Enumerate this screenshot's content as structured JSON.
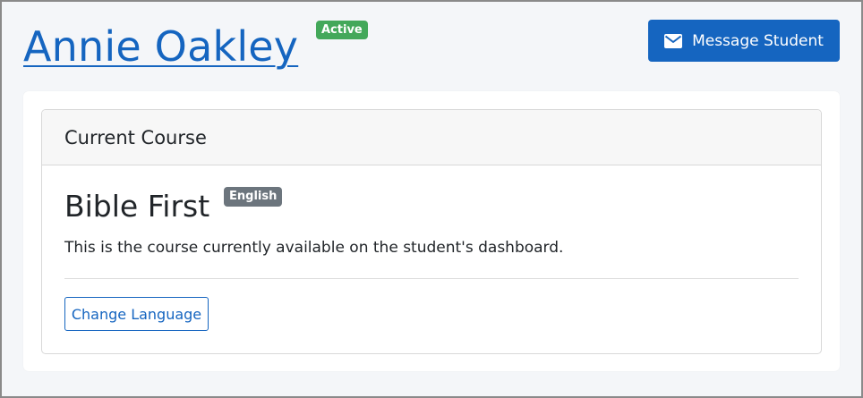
{
  "header": {
    "student_name": "Annie Oakley",
    "status": "Active",
    "message_button_label": "Message Student",
    "message_icon": "envelope-icon"
  },
  "course_card": {
    "title": "Current Course",
    "course_name": "Bible First",
    "language": "English",
    "description": "This is the course currently available on the student's dashboard.",
    "change_language_label": "Change Language"
  },
  "colors": {
    "primary": "#1565c0",
    "active_badge": "#43a85a",
    "language_badge": "#6c757d",
    "page_background": "#f4f6f9"
  }
}
